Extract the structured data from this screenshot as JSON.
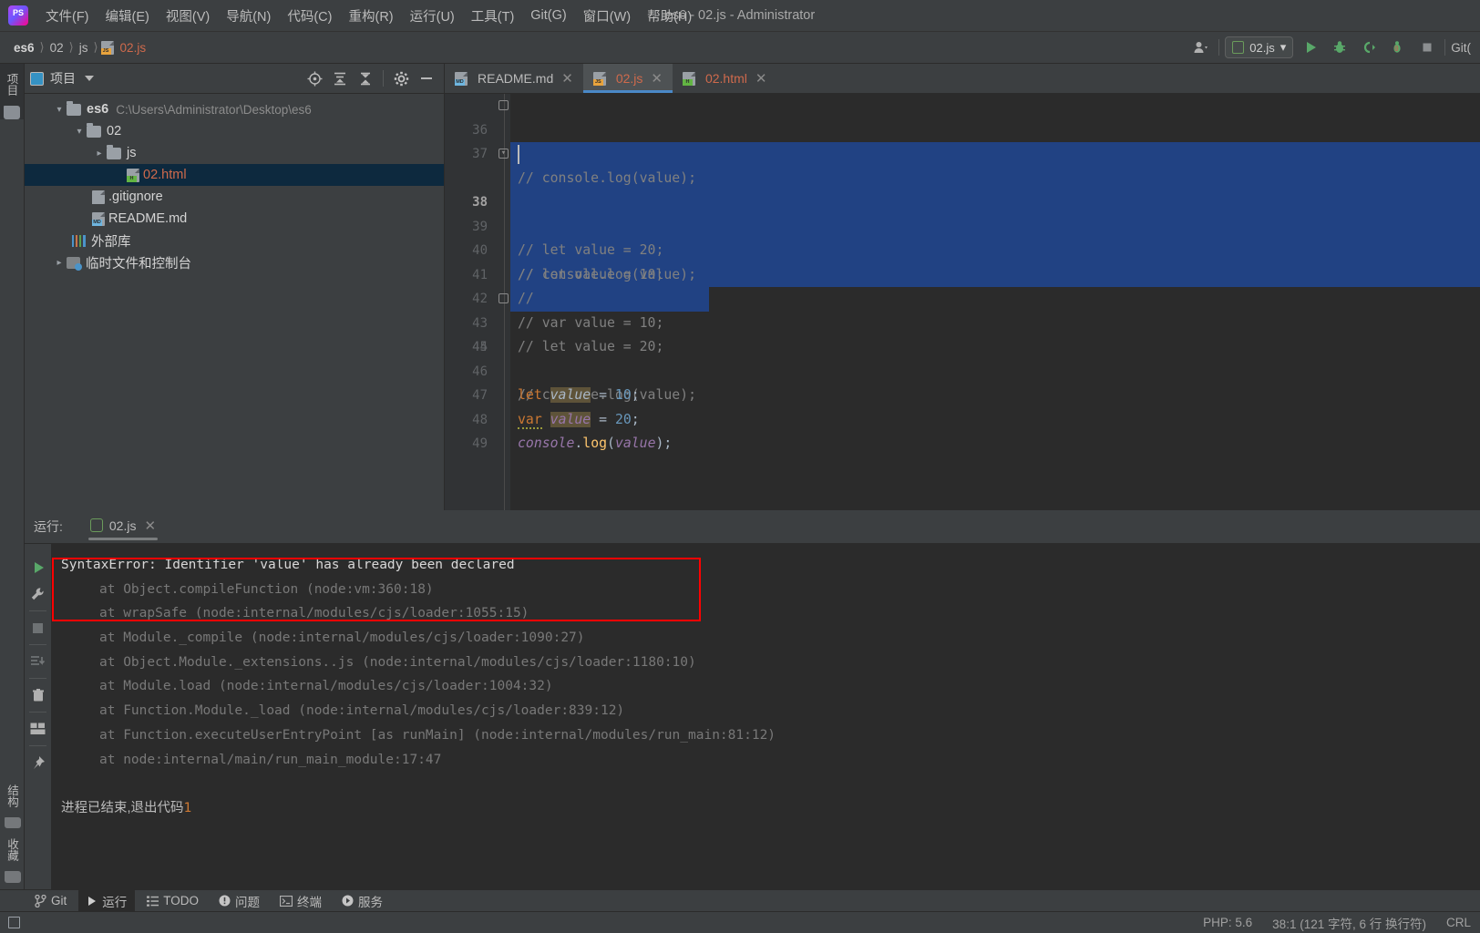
{
  "app": {
    "window_title": "es6 - 02.js - Administrator",
    "logo_text": "PS",
    "accent_blue": "#4a88c7",
    "selection_blue": "#214283",
    "error_red": "#ff0000",
    "file_red": "#cf6a4c"
  },
  "menubar": {
    "items": [
      {
        "label": "文件(F)"
      },
      {
        "label": "编辑(E)"
      },
      {
        "label": "视图(V)"
      },
      {
        "label": "导航(N)"
      },
      {
        "label": "代码(C)"
      },
      {
        "label": "重构(R)"
      },
      {
        "label": "运行(U)"
      },
      {
        "label": "工具(T)"
      },
      {
        "label": "Git(G)"
      },
      {
        "label": "窗口(W)"
      },
      {
        "label": "帮助(H)"
      }
    ]
  },
  "navbar": {
    "breadcrumbs": [
      {
        "label": "es6",
        "icon": "none"
      },
      {
        "label": "02",
        "icon": "none"
      },
      {
        "label": "js",
        "icon": "none"
      },
      {
        "label": "02.js",
        "icon": "js-file-icon"
      }
    ],
    "separator": "〉",
    "run_config": {
      "label": "02.js",
      "icon": "node-icon",
      "chevron": "▾"
    },
    "git_label": "Git(",
    "buttons": [
      {
        "name": "user-account-button",
        "icon": "user-icon"
      },
      {
        "name": "run-button",
        "icon": "play-icon"
      },
      {
        "name": "debug-button",
        "icon": "bug-icon"
      },
      {
        "name": "run-with-coverage-button",
        "icon": "coverage-icon"
      },
      {
        "name": "profile-button",
        "icon": "profiler-icon"
      },
      {
        "name": "stop-button",
        "icon": "stop-icon"
      }
    ]
  },
  "left_strip": {
    "top_label": "项目",
    "bottom_labels": [
      "结构",
      "收藏"
    ]
  },
  "project_panel": {
    "title": "项目",
    "header_buttons": [
      {
        "name": "select-opened-file-button",
        "icon": "target-icon"
      },
      {
        "name": "expand-all-button",
        "icon": "expand-all-icon"
      },
      {
        "name": "collapse-all-button",
        "icon": "collapse-all-icon"
      },
      {
        "name": "settings-button",
        "icon": "gear-icon"
      },
      {
        "name": "hide-button",
        "icon": "minimize-icon"
      }
    ],
    "tree": [
      {
        "label": "es6",
        "path": "C:\\Users\\Administrator\\Desktop\\es6",
        "depth": 0,
        "arrow": "down",
        "icon": "folder-icon",
        "bold": true,
        "selected": false,
        "red": false
      },
      {
        "label": "02",
        "path": "",
        "depth": 1,
        "arrow": "down",
        "icon": "folder-icon",
        "bold": false,
        "selected": false,
        "red": false
      },
      {
        "label": "js",
        "path": "",
        "depth": 2,
        "arrow": "right",
        "icon": "folder-icon",
        "bold": false,
        "selected": false,
        "red": false
      },
      {
        "label": "02.html",
        "path": "",
        "depth": 3,
        "arrow": "none",
        "icon": "html-file-icon",
        "bold": false,
        "selected": true,
        "red": true
      },
      {
        "label": ".gitignore",
        "path": "",
        "depth": 2,
        "arrow": "none",
        "icon": "gitignore-file-icon",
        "bold": false,
        "selected": false,
        "red": false
      },
      {
        "label": "README.md",
        "path": "",
        "depth": 2,
        "arrow": "none",
        "icon": "md-file-icon",
        "bold": false,
        "selected": false,
        "red": false
      },
      {
        "label": "外部库",
        "path": "",
        "depth": 1,
        "arrow": "none",
        "icon": "libraries-icon",
        "bold": false,
        "selected": false,
        "red": false
      },
      {
        "label": "临时文件和控制台",
        "path": "",
        "depth": 1,
        "arrow": "right",
        "icon": "scratches-icon",
        "bold": false,
        "selected": false,
        "red": false
      }
    ]
  },
  "editor": {
    "tabs": [
      {
        "label": "README.md",
        "icon": "md-file-icon",
        "active": false,
        "red": false
      },
      {
        "label": "02.js",
        "icon": "js-file-icon",
        "active": true,
        "red": true
      },
      {
        "label": "02.html",
        "icon": "html-file-icon",
        "active": false,
        "red": true
      }
    ],
    "close_glyph": "✕",
    "first_line_number": 36,
    "lines": [
      {
        "num": 36,
        "selected": false,
        "current": false,
        "fold": "end",
        "tokens": [
          {
            "t": "// console.log(value);",
            "c": "cmt"
          }
        ]
      },
      {
        "num": 37,
        "selected": false,
        "current": false,
        "fold": "none",
        "tokens": []
      },
      {
        "num": 38,
        "selected": true,
        "current": true,
        "fold": "start",
        "tokens": [
          {
            "t": "// let value = 10;",
            "c": "cmt"
          }
        ]
      },
      {
        "num": 39,
        "selected": true,
        "current": false,
        "fold": "none",
        "tokens": [
          {
            "t": "// let value = 20;",
            "c": "cmt"
          }
        ]
      },
      {
        "num": 40,
        "selected": true,
        "current": false,
        "fold": "none",
        "tokens": [
          {
            "t": "// console.log(value);",
            "c": "cmt"
          }
        ]
      },
      {
        "num": 41,
        "selected": true,
        "current": false,
        "fold": "none",
        "tokens": [
          {
            "t": "//",
            "c": "cmt"
          }
        ]
      },
      {
        "num": 42,
        "selected": true,
        "current": false,
        "fold": "none",
        "tokens": [
          {
            "t": "// var value = 10;",
            "c": "cmt"
          }
        ]
      },
      {
        "num": 43,
        "selected": true,
        "current": false,
        "fold": "none",
        "tokens": [
          {
            "t": "// let value = 20;",
            "c": "cmt"
          }
        ]
      },
      {
        "num": 44,
        "selected": true,
        "current": false,
        "fold": "end",
        "tokens": [
          {
            "t": "// console.log(value);",
            "c": "cmt"
          }
        ]
      },
      {
        "num": 45,
        "selected": false,
        "current": false,
        "fold": "none",
        "tokens": []
      },
      {
        "num": 46,
        "selected": false,
        "current": false,
        "fold": "none",
        "tokens": [
          {
            "t": "let ",
            "c": "kw"
          },
          {
            "t": "value",
            "c": "ident-hl2"
          },
          {
            "t": " = ",
            "c": "plain-c"
          },
          {
            "t": "10",
            "c": "num-lit"
          },
          {
            "t": ";",
            "c": "plain-c"
          }
        ]
      },
      {
        "num": 47,
        "selected": false,
        "current": false,
        "fold": "none",
        "tokens": [
          {
            "t": "var",
            "c": "kw warn-underline"
          },
          {
            "t": " ",
            "c": "plain-c"
          },
          {
            "t": "value",
            "c": "ident-hl"
          },
          {
            "t": " = ",
            "c": "plain-c"
          },
          {
            "t": "20",
            "c": "num-lit"
          },
          {
            "t": ";",
            "c": "plain-c"
          }
        ]
      },
      {
        "num": 48,
        "selected": false,
        "current": false,
        "fold": "none",
        "tokens": [
          {
            "t": "console",
            "c": "cls"
          },
          {
            "t": ".",
            "c": "plain-c"
          },
          {
            "t": "log",
            "c": "fn"
          },
          {
            "t": "(",
            "c": "plain-c"
          },
          {
            "t": "value",
            "c": "cls"
          },
          {
            "t": ")",
            "c": "plain-c"
          },
          {
            "t": ";",
            "c": "plain-c"
          }
        ]
      },
      {
        "num": 49,
        "selected": false,
        "current": false,
        "fold": "none",
        "tokens": []
      }
    ]
  },
  "run_panel": {
    "label": "运行:",
    "tab_label": "02.js",
    "tab_icon": "node-icon",
    "close_glyph": "✕",
    "toolbar_buttons": [
      {
        "name": "rerun-button",
        "icon": "play-icon"
      },
      {
        "name": "edit-configuration-button",
        "icon": "wrench-icon"
      },
      {
        "name": "stop-button",
        "icon": "stop-icon"
      },
      {
        "name": "scroll-to-end-button",
        "icon": "scroll-end-icon"
      },
      {
        "name": "clear-all-button",
        "icon": "trash-icon"
      },
      {
        "name": "layout-button",
        "icon": "layout-icon"
      },
      {
        "name": "pin-tab-button",
        "icon": "pin-icon"
      }
    ],
    "console_lines": [
      {
        "text": "SyntaxError: Identifier 'value' has already been declared",
        "style": "err-main",
        "indent": 0
      },
      {
        "text": "at Object.compileFunction (node:vm:360:18)",
        "style": "err-trace",
        "indent": 1
      },
      {
        "text": "at wrapSafe (node:internal/modules/cjs/loader:1055:15)",
        "style": "err-trace",
        "indent": 1
      },
      {
        "text": "at Module._compile (node:internal/modules/cjs/loader:1090:27)",
        "style": "err-trace",
        "indent": 1
      },
      {
        "text": "at Object.Module._extensions..js (node:internal/modules/cjs/loader:1180:10)",
        "style": "err-trace",
        "indent": 1
      },
      {
        "text": "at Module.load (node:internal/modules/cjs/loader:1004:32)",
        "style": "err-trace",
        "indent": 1
      },
      {
        "text": "at Function.Module._load (node:internal/modules/cjs/loader:839:12)",
        "style": "err-trace",
        "indent": 1
      },
      {
        "text": "at Function.executeUserEntryPoint [as runMain] (node:internal/modules/run_main:81:12)",
        "style": "err-trace",
        "indent": 1
      },
      {
        "text": "at node:internal/main/run_main_module:17:47",
        "style": "err-trace",
        "indent": 1
      }
    ],
    "exit_message_prefix": "进程已结束",
    "exit_message_middle": ",退出代码",
    "exit_code": "1",
    "annotation": {
      "shape": "rectangle",
      "color": "#ff0000",
      "encloses": "syntax-error-message"
    }
  },
  "bottom_bar": {
    "items": [
      {
        "label": "Git",
        "icon": "git-branch-icon",
        "active": false
      },
      {
        "label": "运行",
        "icon": "play-icon",
        "active": true
      },
      {
        "label": "TODO",
        "icon": "list-icon",
        "active": false
      },
      {
        "label": "问题",
        "icon": "warning-icon",
        "active": false
      },
      {
        "label": "终端",
        "icon": "terminal-icon",
        "active": false
      },
      {
        "label": "服务",
        "icon": "services-icon",
        "active": false
      }
    ]
  },
  "status_bar": {
    "php_version": "PHP: 5.6",
    "caret_position": "38:1 (121 字符, 6 行 换行符)",
    "line_separator": "CRL"
  }
}
